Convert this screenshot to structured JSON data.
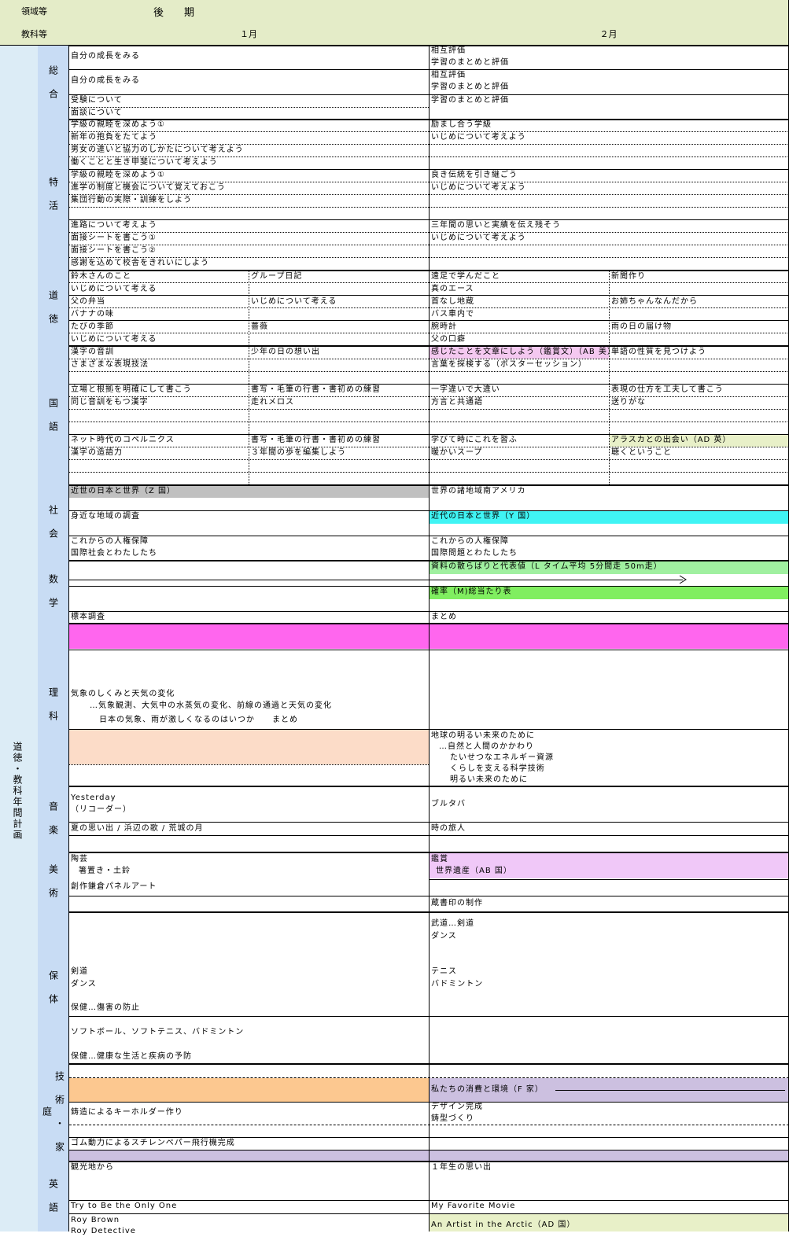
{
  "header": {
    "domain_label": "領域等",
    "period_label": "後　　期",
    "subject_label": "教科等",
    "month_1": "１月",
    "month_2": "２月"
  },
  "side_label": "道徳・教科年間計画",
  "colors": {
    "header_bg": "#e4ecc8",
    "side_bg": "#dcecf6",
    "subject_bg": "#c8dcf4",
    "pink": "#f4c8f0",
    "magenta": "#ff66ee",
    "cyan": "#40f4f4",
    "light_green": "#a0f0a0",
    "green": "#80ee60",
    "gray": "#c0c0c0",
    "peach": "#fcdcc8",
    "orange": "#fcc890",
    "lavender": "#ccc0e0",
    "pale_yellow": "#e8f0c8",
    "violet": "#f0c8f8"
  },
  "subjects": [
    {
      "label": "総\n合"
    },
    {
      "label": "特\n活"
    },
    {
      "label": "道\n徳"
    },
    {
      "label": "国\n語"
    },
    {
      "label": "社\n会"
    },
    {
      "label": "数\n学"
    },
    {
      "label": "理\n科"
    },
    {
      "label": "音\n楽"
    },
    {
      "label": "美\n術"
    },
    {
      "label": "保\n体"
    },
    {
      "label": "技\n術\n・\n家\n庭"
    },
    {
      "label": "英\n語"
    }
  ],
  "sogo": {
    "a1": "自分の成長をみる",
    "a2": "相互評価",
    "a3": "学習のまとめと評価",
    "b1": "自分の成長をみる",
    "b2": "相互評価",
    "b3": "学習のまとめと評価",
    "c1": "受験について",
    "c2": "学習のまとめと評価",
    "c3": "面談について"
  },
  "tokkatsu": {
    "r1a": "学級の親睦を深めよう①",
    "r1b": "励まし合う学級",
    "r2a": "新年の抱負をたてよう",
    "r2b": "いじめについて考えよう",
    "r3a": "男女の違いと協力のしかたについて考えよう",
    "r4a": "働くことと生き甲斐について考えよう",
    "r5a": "学級の親睦を深めよう①",
    "r5b": "良き伝統を引き継ごう",
    "r6a": "進学の制度と機会について覚えておこう",
    "r6b": "いじめについて考えよう",
    "r7a": "集団行動の実際・訓練をしよう",
    "r9a": "進路について考えよう",
    "r9b": "三年間の思いと実績を伝え残そう",
    "r10a": "面接シートを書こう①",
    "r10b": "いじめについて考えよう",
    "r11a": "面接シートを書こう②",
    "r12a": "感謝を込めて校舎をきれいにしよう"
  },
  "dotoku": {
    "r1": [
      "鈴木さんのこと",
      "グループ日記",
      "遠足で学んだこと",
      "新聞作り"
    ],
    "r2": [
      "いじめについて考える",
      "",
      "真のエース",
      ""
    ],
    "r3": [
      "父の弁当",
      "いじめについて考える",
      "首なし地蔵",
      "お姉ちゃんなんだから"
    ],
    "r4": [
      "バナナの味",
      "",
      "バス車内で",
      ""
    ],
    "r5": [
      "たびの季節",
      "薔薇",
      "腕時計",
      "雨の日の届け物"
    ],
    "r6": [
      "いじめについて考える",
      "",
      "父の口癖",
      ""
    ]
  },
  "kokugo": {
    "r1": [
      "漢字の音訓",
      "少年の日の想い出",
      "感じたことを文章にしよう（鑑賞文）（AB 美）",
      "単語の性質を見つけよう"
    ],
    "r2": [
      "さまざまな表現技法",
      "",
      "言葉を探検する（ポスターセッション）",
      ""
    ],
    "r4": [
      "立場と根拠を明確にして書こう",
      "書写・毛筆の行書・書初めの練習",
      "一字違いで大違い",
      "表現の仕方を工夫して書こう"
    ],
    "r5": [
      "同じ音訓をもつ漢字",
      "走れメロス",
      "方言と共通語",
      "送りがな"
    ],
    "r8": [
      "ネット時代のコペルニクス",
      "書写・毛筆の行書・書初めの練習",
      "学びて時にこれを習ふ",
      "アラスカとの出会い（AD 英）"
    ],
    "r9": [
      "漢字の造語力",
      "３年間の歩を編集しよう",
      "暖かいスープ",
      "聴くということ"
    ]
  },
  "shakai": {
    "a1": "近世の日本と世界（Z 国）",
    "a2": "世界の諸地域南アメリカ",
    "b1": "身近な地域の調査",
    "b2": "近代の日本と世界（Y 国）",
    "c1": "これからの人権保障",
    "c2": "これからの人権保障",
    "c3": "国際社会とわたしたち",
    "c4": "国際問題とわたしたち"
  },
  "sugaku": {
    "a2": "資料の散らばりと代表値（L タイム平均 5分間走 50m走）",
    "b2": "確率（M)総当たり表",
    "c1": "標本調査",
    "c2": "まとめ"
  },
  "rika": {
    "l1": "気象のしくみと天気の変化",
    "l2": "…気象観測、大気中の水蒸気の変化、前線の通過と天気の変化",
    "l3": "日本の気象、雨が激しくなるのはいつか　　まとめ",
    "m1": "地球の明るい未来のために",
    "m2": "…自然と人間のかかわり",
    "m3": "たいせつなエネルギー資源",
    "m4": "くらしを支える科学技術",
    "m5": "明るい未来のために"
  },
  "ongaku": {
    "a1": "Yesterday",
    "a2": "（リコーダー）",
    "a3": "ブルタバ",
    "b1": "夏の思い出 /  浜辺の歌 /  荒城の月",
    "b2": "時の旅人"
  },
  "bijutsu": {
    "a1": "陶芸",
    "a2": "箸置き・土鈴",
    "a3": "鑑賞",
    "a4": "世界遺産（AB 国）",
    "b1": "創作鎌倉パネルアート",
    "c2": "蔵書印の制作"
  },
  "hotai": {
    "a2": "武道…剣道",
    "a3": "ダンス",
    "b1": "剣道",
    "b2": "ダンス",
    "b3": "テニス",
    "b4": "バドミントン",
    "c1": "保健…傷害の防止",
    "d1": "ソフトボール、ソフトテニス、バドミントン",
    "e1": "保健…健康な生活と疾病の予防"
  },
  "gika": {
    "a2": "私たちの消費と環境（F 家）",
    "b1": "鋳造によるキーホルダー作り",
    "b2": "デザイン完成",
    "b3": "鋳型づくり",
    "c1": "ゴム動力によるスチレンペパー飛行機完成"
  },
  "eigo": {
    "a1": "観光地から",
    "a2": "１年生の思い出",
    "b1": "Try to Be the Only One",
    "b2": "My Favorite Movie",
    "c1": "Roy Brown",
    "c2": "An Artist in the Arctic（AD 国）",
    "c3": "Roy Detective"
  }
}
